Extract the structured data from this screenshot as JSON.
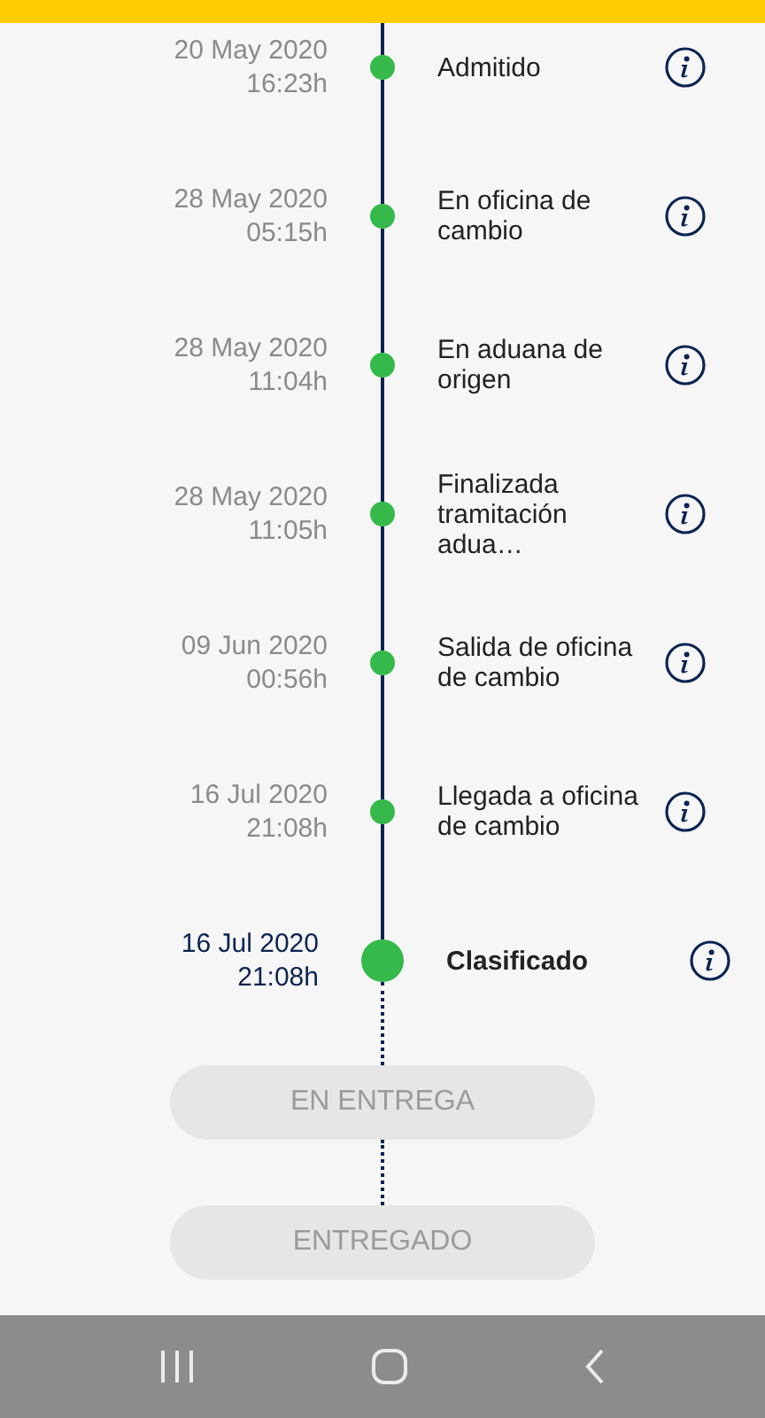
{
  "events": [
    {
      "date": "20 May 2020",
      "time": "16:23h",
      "label": "Admitido",
      "kind": "done"
    },
    {
      "date": "28 May 2020",
      "time": "05:15h",
      "label": "En oficina de cambio",
      "kind": "done"
    },
    {
      "date": "28 May 2020",
      "time": "11:04h",
      "label": "En aduana de origen",
      "kind": "done"
    },
    {
      "date": "28 May 2020",
      "time": "11:05h",
      "label": "Finalizada tramitación adua…",
      "kind": "done"
    },
    {
      "date": "09 Jun 2020",
      "time": "00:56h",
      "label": "Salida de oficina de cambio",
      "kind": "done"
    },
    {
      "date": "16 Jul 2020",
      "time": "21:08h",
      "label": "Llegada a oficina de cambio",
      "kind": "done"
    },
    {
      "date": "16 Jul 2020",
      "time": "21:08h",
      "label": "Clasificado",
      "kind": "current"
    }
  ],
  "pending_steps": [
    {
      "label": "EN ENTREGA"
    },
    {
      "label": "ENTREGADO"
    }
  ]
}
